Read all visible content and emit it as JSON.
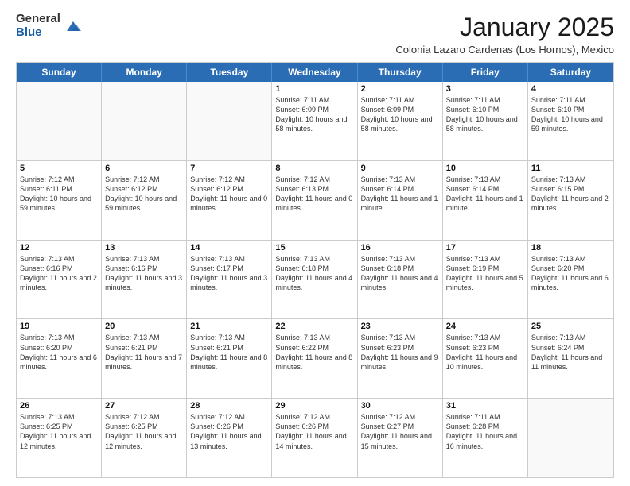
{
  "header": {
    "logo_general": "General",
    "logo_blue": "Blue",
    "month_title": "January 2025",
    "subtitle": "Colonia Lazaro Cardenas (Los Hornos), Mexico"
  },
  "calendar": {
    "days_of_week": [
      "Sunday",
      "Monday",
      "Tuesday",
      "Wednesday",
      "Thursday",
      "Friday",
      "Saturday"
    ],
    "rows": [
      [
        {
          "day": "",
          "info": ""
        },
        {
          "day": "",
          "info": ""
        },
        {
          "day": "",
          "info": ""
        },
        {
          "day": "1",
          "info": "Sunrise: 7:11 AM\nSunset: 6:09 PM\nDaylight: 10 hours and 58 minutes."
        },
        {
          "day": "2",
          "info": "Sunrise: 7:11 AM\nSunset: 6:09 PM\nDaylight: 10 hours and 58 minutes."
        },
        {
          "day": "3",
          "info": "Sunrise: 7:11 AM\nSunset: 6:10 PM\nDaylight: 10 hours and 58 minutes."
        },
        {
          "day": "4",
          "info": "Sunrise: 7:11 AM\nSunset: 6:10 PM\nDaylight: 10 hours and 59 minutes."
        }
      ],
      [
        {
          "day": "5",
          "info": "Sunrise: 7:12 AM\nSunset: 6:11 PM\nDaylight: 10 hours and 59 minutes."
        },
        {
          "day": "6",
          "info": "Sunrise: 7:12 AM\nSunset: 6:12 PM\nDaylight: 10 hours and 59 minutes."
        },
        {
          "day": "7",
          "info": "Sunrise: 7:12 AM\nSunset: 6:12 PM\nDaylight: 11 hours and 0 minutes."
        },
        {
          "day": "8",
          "info": "Sunrise: 7:12 AM\nSunset: 6:13 PM\nDaylight: 11 hours and 0 minutes."
        },
        {
          "day": "9",
          "info": "Sunrise: 7:13 AM\nSunset: 6:14 PM\nDaylight: 11 hours and 1 minute."
        },
        {
          "day": "10",
          "info": "Sunrise: 7:13 AM\nSunset: 6:14 PM\nDaylight: 11 hours and 1 minute."
        },
        {
          "day": "11",
          "info": "Sunrise: 7:13 AM\nSunset: 6:15 PM\nDaylight: 11 hours and 2 minutes."
        }
      ],
      [
        {
          "day": "12",
          "info": "Sunrise: 7:13 AM\nSunset: 6:16 PM\nDaylight: 11 hours and 2 minutes."
        },
        {
          "day": "13",
          "info": "Sunrise: 7:13 AM\nSunset: 6:16 PM\nDaylight: 11 hours and 3 minutes."
        },
        {
          "day": "14",
          "info": "Sunrise: 7:13 AM\nSunset: 6:17 PM\nDaylight: 11 hours and 3 minutes."
        },
        {
          "day": "15",
          "info": "Sunrise: 7:13 AM\nSunset: 6:18 PM\nDaylight: 11 hours and 4 minutes."
        },
        {
          "day": "16",
          "info": "Sunrise: 7:13 AM\nSunset: 6:18 PM\nDaylight: 11 hours and 4 minutes."
        },
        {
          "day": "17",
          "info": "Sunrise: 7:13 AM\nSunset: 6:19 PM\nDaylight: 11 hours and 5 minutes."
        },
        {
          "day": "18",
          "info": "Sunrise: 7:13 AM\nSunset: 6:20 PM\nDaylight: 11 hours and 6 minutes."
        }
      ],
      [
        {
          "day": "19",
          "info": "Sunrise: 7:13 AM\nSunset: 6:20 PM\nDaylight: 11 hours and 6 minutes."
        },
        {
          "day": "20",
          "info": "Sunrise: 7:13 AM\nSunset: 6:21 PM\nDaylight: 11 hours and 7 minutes."
        },
        {
          "day": "21",
          "info": "Sunrise: 7:13 AM\nSunset: 6:21 PM\nDaylight: 11 hours and 8 minutes."
        },
        {
          "day": "22",
          "info": "Sunrise: 7:13 AM\nSunset: 6:22 PM\nDaylight: 11 hours and 8 minutes."
        },
        {
          "day": "23",
          "info": "Sunrise: 7:13 AM\nSunset: 6:23 PM\nDaylight: 11 hours and 9 minutes."
        },
        {
          "day": "24",
          "info": "Sunrise: 7:13 AM\nSunset: 6:23 PM\nDaylight: 11 hours and 10 minutes."
        },
        {
          "day": "25",
          "info": "Sunrise: 7:13 AM\nSunset: 6:24 PM\nDaylight: 11 hours and 11 minutes."
        }
      ],
      [
        {
          "day": "26",
          "info": "Sunrise: 7:13 AM\nSunset: 6:25 PM\nDaylight: 11 hours and 12 minutes."
        },
        {
          "day": "27",
          "info": "Sunrise: 7:12 AM\nSunset: 6:25 PM\nDaylight: 11 hours and 12 minutes."
        },
        {
          "day": "28",
          "info": "Sunrise: 7:12 AM\nSunset: 6:26 PM\nDaylight: 11 hours and 13 minutes."
        },
        {
          "day": "29",
          "info": "Sunrise: 7:12 AM\nSunset: 6:26 PM\nDaylight: 11 hours and 14 minutes."
        },
        {
          "day": "30",
          "info": "Sunrise: 7:12 AM\nSunset: 6:27 PM\nDaylight: 11 hours and 15 minutes."
        },
        {
          "day": "31",
          "info": "Sunrise: 7:11 AM\nSunset: 6:28 PM\nDaylight: 11 hours and 16 minutes."
        },
        {
          "day": "",
          "info": ""
        }
      ]
    ]
  }
}
